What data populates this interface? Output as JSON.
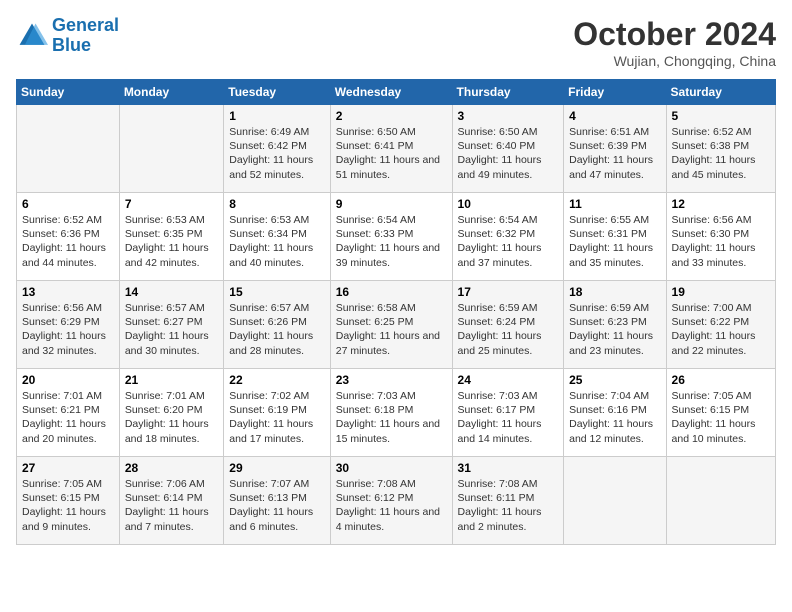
{
  "header": {
    "logo_line1": "General",
    "logo_line2": "Blue",
    "month": "October 2024",
    "location": "Wujian, Chongqing, China"
  },
  "days_of_week": [
    "Sunday",
    "Monday",
    "Tuesday",
    "Wednesday",
    "Thursday",
    "Friday",
    "Saturday"
  ],
  "weeks": [
    {
      "days": [
        {
          "num": "",
          "content": ""
        },
        {
          "num": "",
          "content": ""
        },
        {
          "num": "1",
          "content": "Sunrise: 6:49 AM\nSunset: 6:42 PM\nDaylight: 11 hours and 52 minutes."
        },
        {
          "num": "2",
          "content": "Sunrise: 6:50 AM\nSunset: 6:41 PM\nDaylight: 11 hours and 51 minutes."
        },
        {
          "num": "3",
          "content": "Sunrise: 6:50 AM\nSunset: 6:40 PM\nDaylight: 11 hours and 49 minutes."
        },
        {
          "num": "4",
          "content": "Sunrise: 6:51 AM\nSunset: 6:39 PM\nDaylight: 11 hours and 47 minutes."
        },
        {
          "num": "5",
          "content": "Sunrise: 6:52 AM\nSunset: 6:38 PM\nDaylight: 11 hours and 45 minutes."
        }
      ]
    },
    {
      "days": [
        {
          "num": "6",
          "content": "Sunrise: 6:52 AM\nSunset: 6:36 PM\nDaylight: 11 hours and 44 minutes."
        },
        {
          "num": "7",
          "content": "Sunrise: 6:53 AM\nSunset: 6:35 PM\nDaylight: 11 hours and 42 minutes."
        },
        {
          "num": "8",
          "content": "Sunrise: 6:53 AM\nSunset: 6:34 PM\nDaylight: 11 hours and 40 minutes."
        },
        {
          "num": "9",
          "content": "Sunrise: 6:54 AM\nSunset: 6:33 PM\nDaylight: 11 hours and 39 minutes."
        },
        {
          "num": "10",
          "content": "Sunrise: 6:54 AM\nSunset: 6:32 PM\nDaylight: 11 hours and 37 minutes."
        },
        {
          "num": "11",
          "content": "Sunrise: 6:55 AM\nSunset: 6:31 PM\nDaylight: 11 hours and 35 minutes."
        },
        {
          "num": "12",
          "content": "Sunrise: 6:56 AM\nSunset: 6:30 PM\nDaylight: 11 hours and 33 minutes."
        }
      ]
    },
    {
      "days": [
        {
          "num": "13",
          "content": "Sunrise: 6:56 AM\nSunset: 6:29 PM\nDaylight: 11 hours and 32 minutes."
        },
        {
          "num": "14",
          "content": "Sunrise: 6:57 AM\nSunset: 6:27 PM\nDaylight: 11 hours and 30 minutes."
        },
        {
          "num": "15",
          "content": "Sunrise: 6:57 AM\nSunset: 6:26 PM\nDaylight: 11 hours and 28 minutes."
        },
        {
          "num": "16",
          "content": "Sunrise: 6:58 AM\nSunset: 6:25 PM\nDaylight: 11 hours and 27 minutes."
        },
        {
          "num": "17",
          "content": "Sunrise: 6:59 AM\nSunset: 6:24 PM\nDaylight: 11 hours and 25 minutes."
        },
        {
          "num": "18",
          "content": "Sunrise: 6:59 AM\nSunset: 6:23 PM\nDaylight: 11 hours and 23 minutes."
        },
        {
          "num": "19",
          "content": "Sunrise: 7:00 AM\nSunset: 6:22 PM\nDaylight: 11 hours and 22 minutes."
        }
      ]
    },
    {
      "days": [
        {
          "num": "20",
          "content": "Sunrise: 7:01 AM\nSunset: 6:21 PM\nDaylight: 11 hours and 20 minutes."
        },
        {
          "num": "21",
          "content": "Sunrise: 7:01 AM\nSunset: 6:20 PM\nDaylight: 11 hours and 18 minutes."
        },
        {
          "num": "22",
          "content": "Sunrise: 7:02 AM\nSunset: 6:19 PM\nDaylight: 11 hours and 17 minutes."
        },
        {
          "num": "23",
          "content": "Sunrise: 7:03 AM\nSunset: 6:18 PM\nDaylight: 11 hours and 15 minutes."
        },
        {
          "num": "24",
          "content": "Sunrise: 7:03 AM\nSunset: 6:17 PM\nDaylight: 11 hours and 14 minutes."
        },
        {
          "num": "25",
          "content": "Sunrise: 7:04 AM\nSunset: 6:16 PM\nDaylight: 11 hours and 12 minutes."
        },
        {
          "num": "26",
          "content": "Sunrise: 7:05 AM\nSunset: 6:15 PM\nDaylight: 11 hours and 10 minutes."
        }
      ]
    },
    {
      "days": [
        {
          "num": "27",
          "content": "Sunrise: 7:05 AM\nSunset: 6:15 PM\nDaylight: 11 hours and 9 minutes."
        },
        {
          "num": "28",
          "content": "Sunrise: 7:06 AM\nSunset: 6:14 PM\nDaylight: 11 hours and 7 minutes."
        },
        {
          "num": "29",
          "content": "Sunrise: 7:07 AM\nSunset: 6:13 PM\nDaylight: 11 hours and 6 minutes."
        },
        {
          "num": "30",
          "content": "Sunrise: 7:08 AM\nSunset: 6:12 PM\nDaylight: 11 hours and 4 minutes."
        },
        {
          "num": "31",
          "content": "Sunrise: 7:08 AM\nSunset: 6:11 PM\nDaylight: 11 hours and 2 minutes."
        },
        {
          "num": "",
          "content": ""
        },
        {
          "num": "",
          "content": ""
        }
      ]
    }
  ]
}
